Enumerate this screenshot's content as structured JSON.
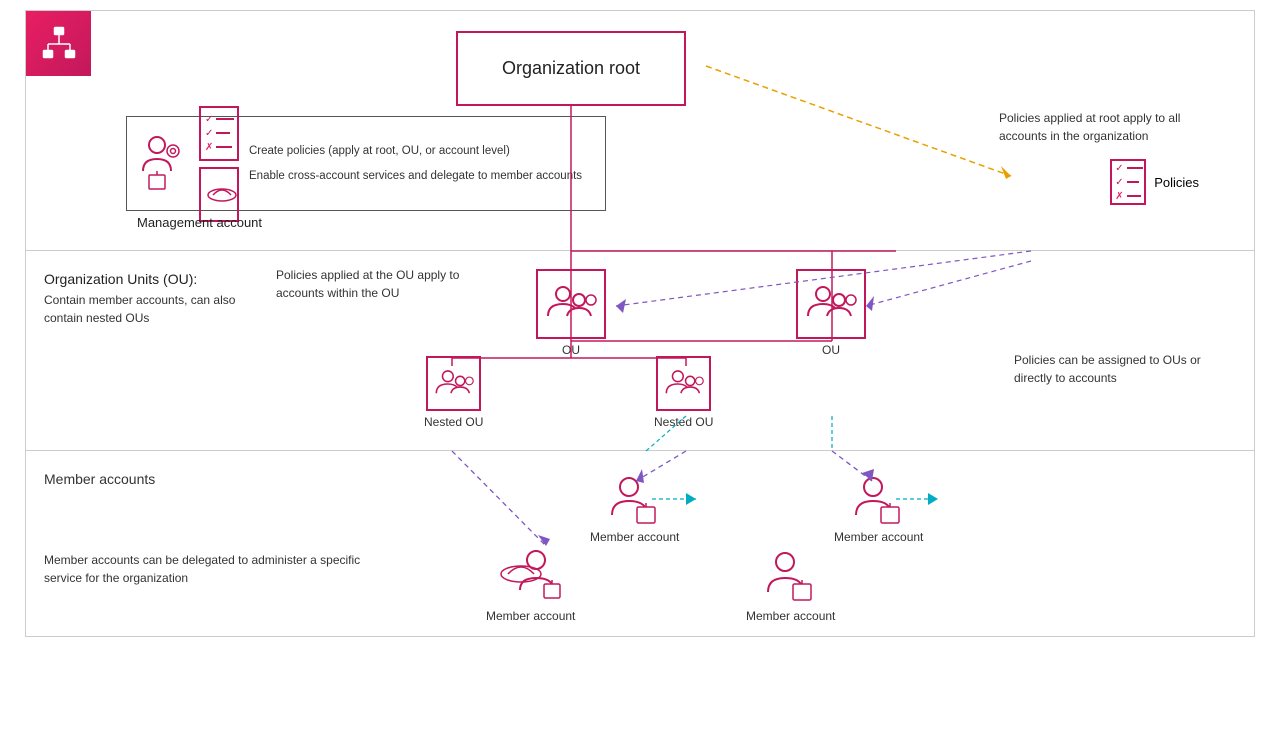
{
  "logo": {
    "alt": "AWS Organizations icon"
  },
  "root_section": {
    "org_root_label": "Organization root",
    "annotation_policies_root": "Policies applied at root apply to all\naccounts in the organization",
    "policies_label": "Policies",
    "mgmt_box": {
      "label": "Management account",
      "text1": "Create policies (apply at root, OU,\nor account level)",
      "text2": "Enable cross-account services\nand delegate to member accounts"
    }
  },
  "ou_section": {
    "annotation_ou_policies": "Policies applied at the OU apply to\naccounts within the OU",
    "ou_label1": "OU",
    "ou_label2": "OU",
    "nested_ou_label1": "Nested OU",
    "nested_ou_label2": "Nested OU",
    "section_title": "Organization Units (OU):",
    "section_desc": "Contain member accounts, can also\ncontain nested OUs",
    "annotation_policies_ou": "Policies can be assigned to\nOUs or directly to accounts"
  },
  "member_section": {
    "section_title": "Member accounts",
    "section_desc": "Member accounts can be delegated to administer\na specific service for the organization",
    "account1": "Member account",
    "account2": "Member account",
    "account3": "Member account",
    "account4": "Member account"
  }
}
